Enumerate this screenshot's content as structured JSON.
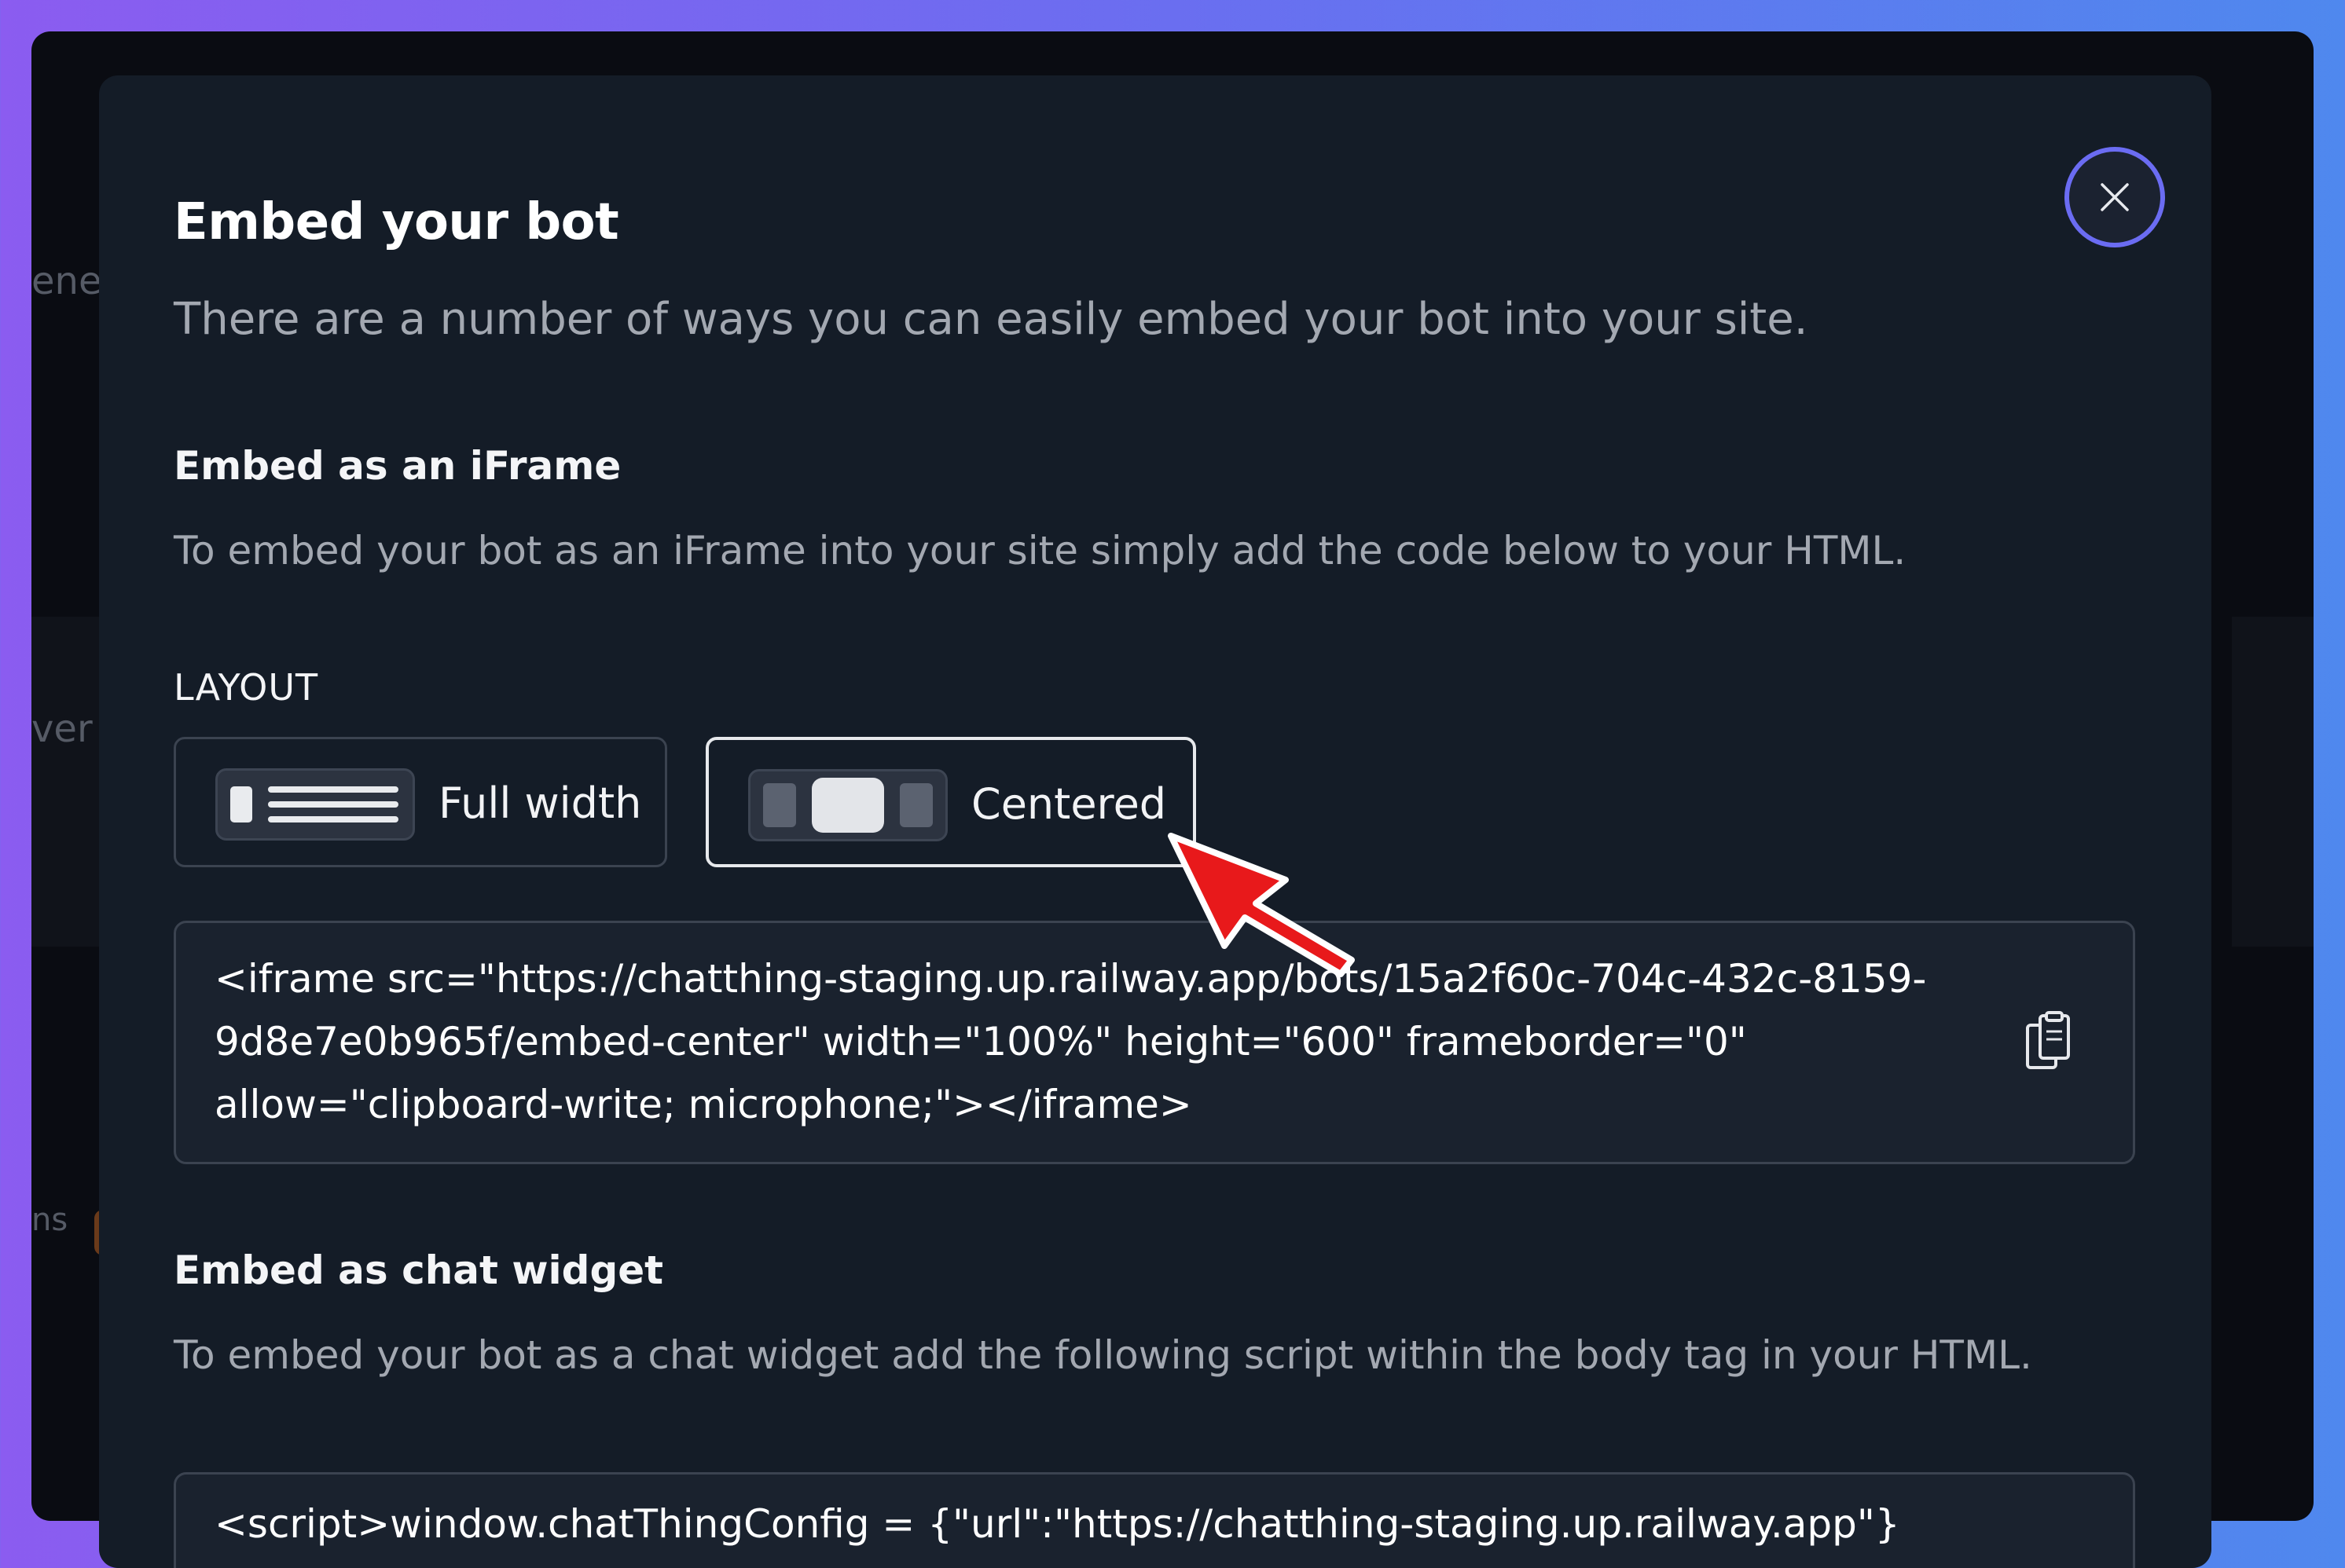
{
  "background_fragments": [
    "ene",
    "ver",
    "ns"
  ],
  "modal": {
    "title": "Embed your bot",
    "subtitle": "There are a number of ways you can easily embed your bot into your site.",
    "close_icon": "close-icon"
  },
  "iframe_section": {
    "heading": "Embed as an iFrame",
    "description": "To embed your bot as an iFrame into your site simply add the code below to your HTML.",
    "layout_label": "LAYOUT",
    "options": [
      {
        "label": "Full width",
        "icon": "full-width-layout-icon",
        "selected": false
      },
      {
        "label": "Centered",
        "icon": "centered-layout-icon",
        "selected": true
      }
    ],
    "code_lines": [
      "<iframe src=\"https://chatthing-staging.up.railway.app/bots/15a2f60c-704c-432c-8159-",
      "9d8e7e0b965f/embed-center\" width=\"100%\" height=\"600\" frameborder=\"0\"",
      "allow=\"clipboard-write; microphone;\"></iframe>"
    ],
    "copy_icon": "clipboard-copy-icon"
  },
  "widget_section": {
    "heading": "Embed as chat widget",
    "description": "To embed your bot as a chat widget add the following script within the body tag in your HTML.",
    "code_line": "<script>window.chatThingConfig = {\"url\":\"https://chatthing-staging.up.railway.app\"}"
  },
  "annotation": {
    "icon": "red-arrow-pointer",
    "color": "#e8191b"
  },
  "colors": {
    "accent": "#6b6cf2",
    "modal_bg": "#141c27",
    "arrow": "#e8191b"
  }
}
